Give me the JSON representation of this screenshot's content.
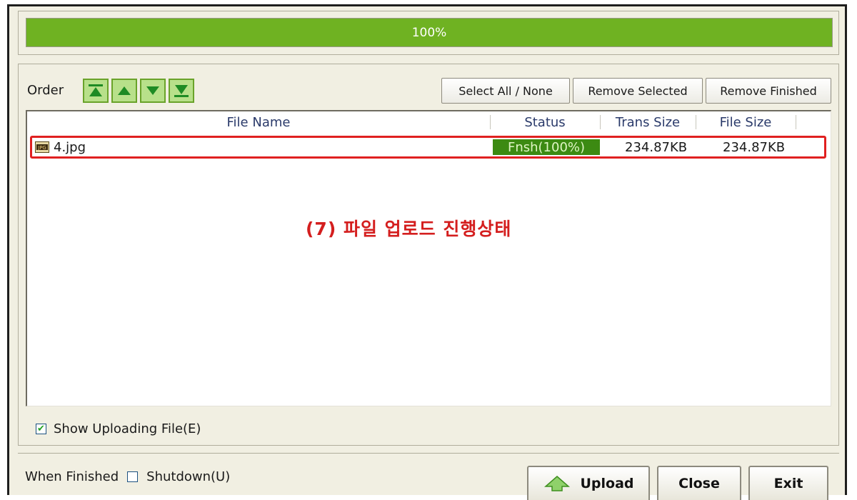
{
  "progress": {
    "percent": 100,
    "text": "100%"
  },
  "order": {
    "label": "Order",
    "buttons": [
      {
        "name": "move-top-button",
        "icon": "move-top-icon"
      },
      {
        "name": "move-up-button",
        "icon": "move-up-icon"
      },
      {
        "name": "move-down-button",
        "icon": "move-down-icon"
      },
      {
        "name": "move-bottom-button",
        "icon": "move-bottom-icon"
      }
    ]
  },
  "toolbar": {
    "select_all": "Select All / None",
    "remove_selected": "Remove Selected",
    "remove_finished": "Remove Finished"
  },
  "table": {
    "headers": {
      "file_name": "File Name",
      "status": "Status",
      "trans_size": "Trans Size",
      "file_size": "File Size"
    },
    "rows": [
      {
        "icon": "jpg-file-icon",
        "file_name": "4.jpg",
        "status": "Fnsh(100%)",
        "trans_size": "234.87KB",
        "file_size": "234.87KB"
      }
    ]
  },
  "annotation": "(7) 파일 업로드 진행상태",
  "options": {
    "show_uploading": "Show Uploading File(E)",
    "show_uploading_checked": true,
    "when_finished": "When Finished",
    "shutdown": "Shutdown(U)",
    "shutdown_checked": false
  },
  "actions": {
    "upload": "Upload",
    "close": "Close",
    "exit": "Exit"
  },
  "colors": {
    "progress": "#6fb222",
    "status": "#3c8a12",
    "annotation": "#d41e1e"
  }
}
